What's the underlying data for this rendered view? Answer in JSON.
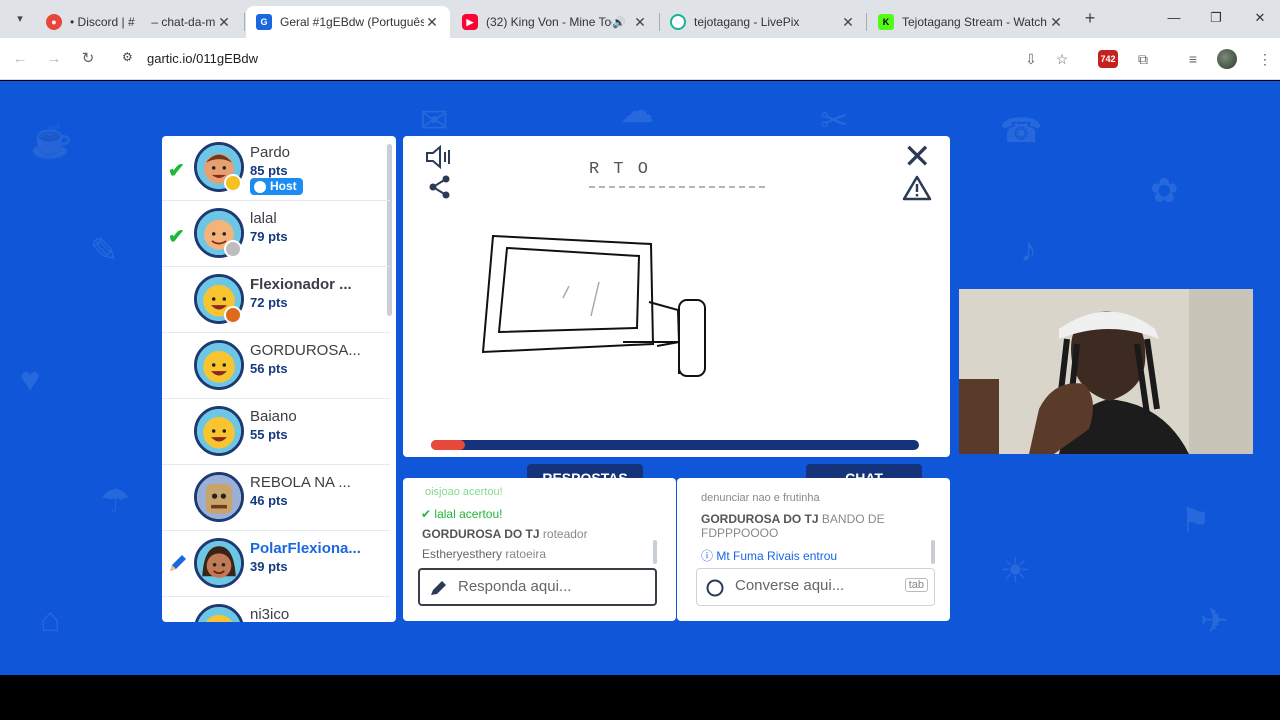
{
  "browser": {
    "tabs": [
      {
        "title": "• Discord | #     – chat-da-m",
        "favicon": "discord-icon",
        "color": "#e8453c"
      },
      {
        "title": "Geral #1gEBdw (Português)",
        "favicon": "gartic-icon",
        "color": "#1b67e0",
        "active": true
      },
      {
        "title": "(32) King Von - Mine Toc",
        "favicon": "youtube-icon",
        "color": "#ff0033"
      },
      {
        "title": "tejotagang - LivePix",
        "favicon": "livepix-icon",
        "color": "#16b39a"
      },
      {
        "title": "Tejotagang Stream - Watch",
        "favicon": "kick-icon",
        "color": "#53fc18"
      }
    ],
    "url": "gartic.io/011gEBdw",
    "extension_badge": "742"
  },
  "players": [
    {
      "name": "Pardo",
      "pts": "85 pts",
      "checked": true,
      "host_label": "Host",
      "status_color": "#f5c020",
      "face": "#e8a070"
    },
    {
      "name": "lalal",
      "pts": "79 pts",
      "checked": true,
      "status_color": "#bdbdbd",
      "face": "#f3b37a"
    },
    {
      "name": "Flexionador ...",
      "pts": "72 pts",
      "status_color": "#e06a1b",
      "face": "#f8c531",
      "bold": true
    },
    {
      "name": "GORDUROSA...",
      "pts": "56 pts",
      "face": "#f8c531"
    },
    {
      "name": "Baiano",
      "pts": "55 pts",
      "face": "#f8c531"
    },
    {
      "name": "REBOLA NA ...",
      "pts": "46 pts",
      "face": "#9bb0d8"
    },
    {
      "name": "PolarFlexiona...",
      "pts": "39 pts",
      "face": "#c07a55",
      "drawing": true
    },
    {
      "name": "ni3ico",
      "pts": "",
      "face": "#f8c531"
    }
  ],
  "board": {
    "hint_letters": "R T O",
    "timer_fraction": 0.07
  },
  "answers": {
    "label": "RESPOSTAS",
    "lines": [
      {
        "name": "",
        "text": "acertou!",
        "partial": "oisjoao"
      },
      {
        "name": "lalal",
        "text": "acertou!"
      },
      {
        "name": "GORDUROSA DO TJ",
        "text": "roteador"
      },
      {
        "name": "Estheryesthery",
        "text": "ratoeira"
      }
    ],
    "placeholder": "Responda aqui..."
  },
  "chat": {
    "label": "CHAT",
    "lines": [
      {
        "name": "",
        "text": "denunciar nao e frutinha"
      },
      {
        "name": "GORDUROSA DO TJ",
        "text": "BANDO DE FDPPPOOOO"
      },
      {
        "name": "Mt Fuma Rivais",
        "text": "entrou"
      }
    ],
    "placeholder": "Converse aqui...",
    "shortcut": "tab"
  }
}
